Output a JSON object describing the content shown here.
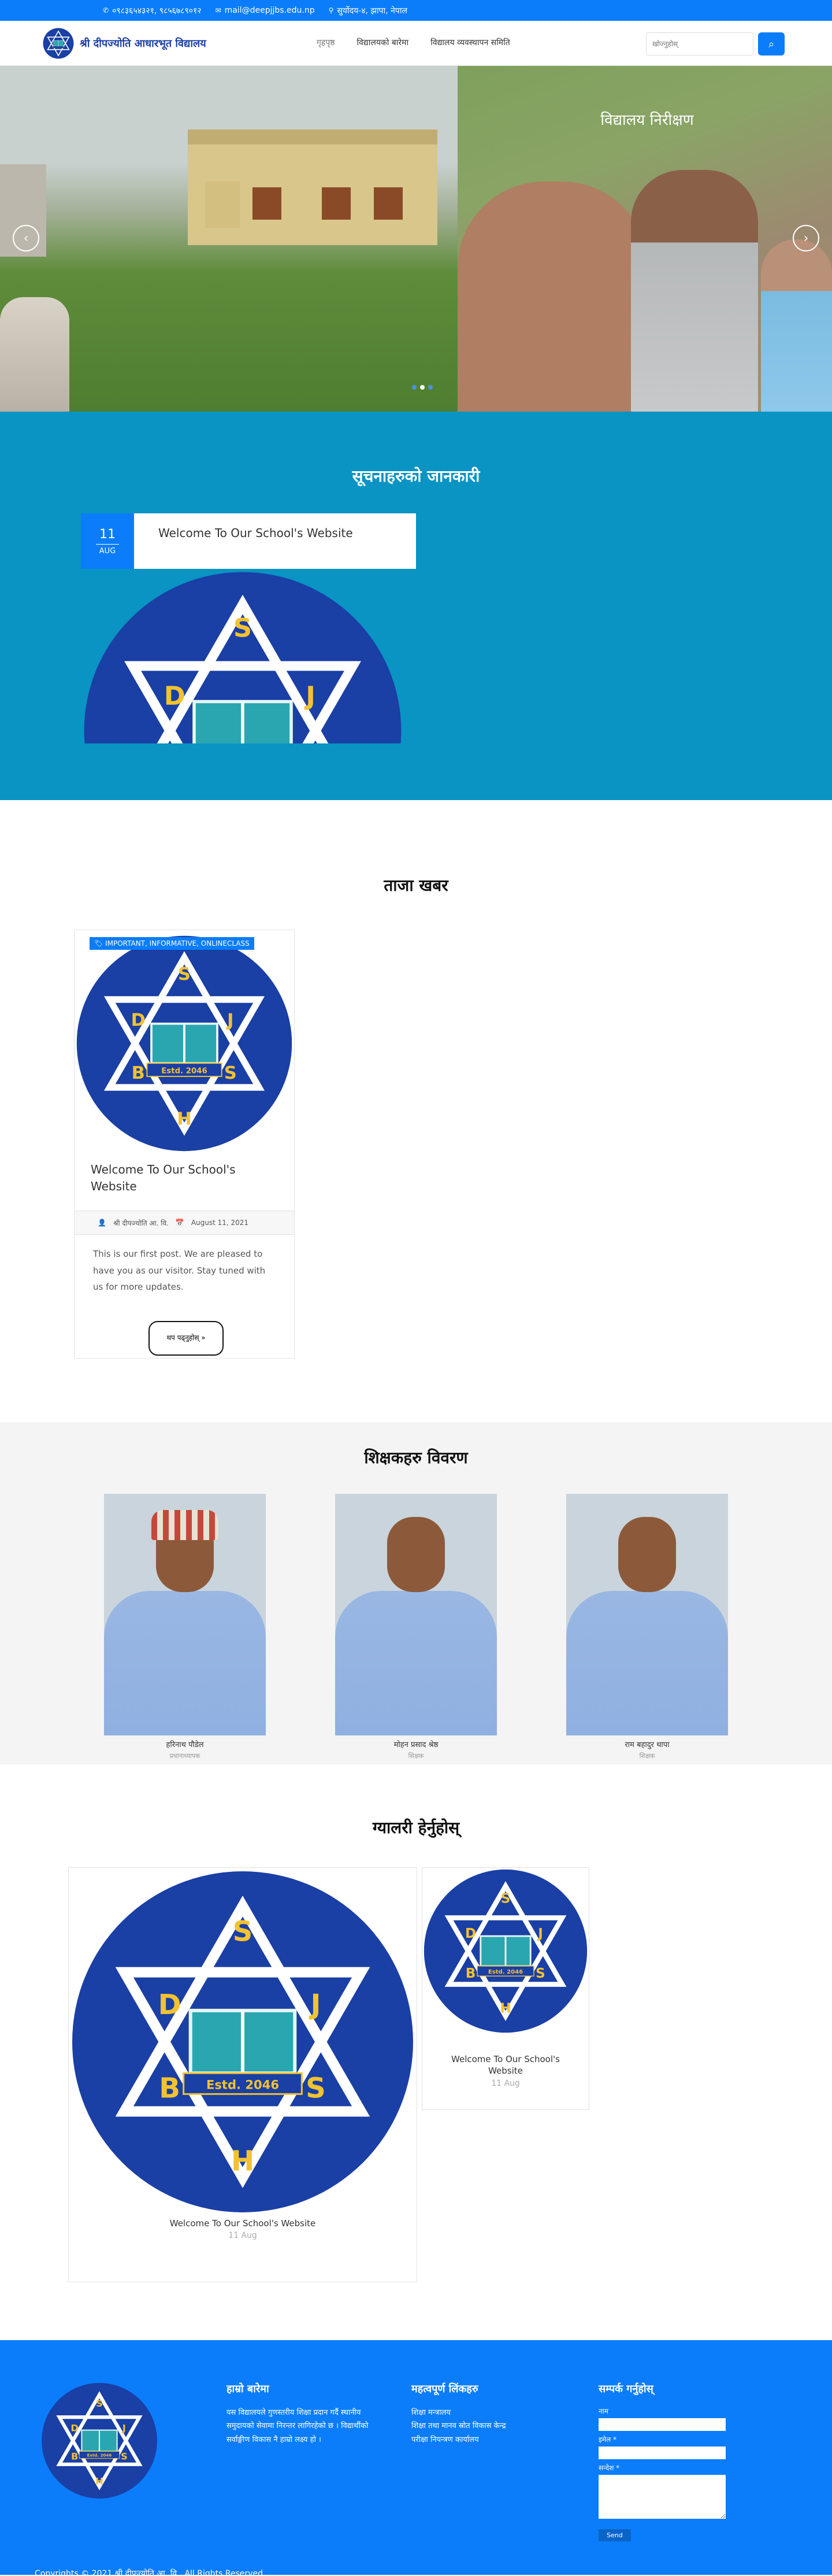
{
  "colors": {
    "primary": "#0b7dfa",
    "notice_bg": "#0994c4",
    "staff_bg": "#f4f4f4",
    "logo_blue": "#1a3fa5",
    "logo_gold": "#f2c230"
  },
  "topbar": {
    "phone_icon": "phone-icon",
    "phone": "०९८३६५४३२१, ९८५६७८९०१२",
    "mail_icon": "mail-icon",
    "email": "mail@deepjjbs.edu.np",
    "location_icon": "location-pin-icon",
    "address": "सुर्योदय-४, झापा, नेपाल"
  },
  "header": {
    "school_name": "श्री दीपज्योति आधारभूत विद्यालय",
    "nav": [
      {
        "label": "गृहपृष्ठ",
        "active": true
      },
      {
        "label": "विद्यालयको बारेमा",
        "active": false
      },
      {
        "label": "विद्यालय व्यवस्थापन समिति",
        "active": false
      }
    ],
    "search_placeholder": "खोज्नुहोस्",
    "search_icon": "search-icon"
  },
  "logo": {
    "letters": [
      "S",
      "D",
      "J",
      "B",
      "S",
      "H"
    ],
    "estd": "Estd. 2046"
  },
  "slider": {
    "caption": "विद्यालय निरीक्षण",
    "prev_icon": "chevron-left-icon",
    "next_icon": "chevron-right-icon",
    "dot_count": 3,
    "active_dot": 1
  },
  "notices": {
    "title": "सूचनाहरुको जानकारी",
    "items": [
      {
        "day": "11",
        "month": "AUG",
        "title": "Welcome To Our School's Website"
      }
    ]
  },
  "blog": {
    "title": "ताजा खबर",
    "posts": [
      {
        "tag_icon": "tag-icon",
        "tags": "IMPORTANT, INFORMATIVE, ONLINECLASS",
        "title": "Welcome To Our School's Website",
        "author_icon": "user-icon",
        "author": "श्री दीपज्योति आ. वि.",
        "date_icon": "calendar-icon",
        "date": "August 11, 2021",
        "excerpt": "This is our first post. We are pleased to have you as our visitor. Stay tuned with us for more updates.",
        "button": "थप पढ्नुहोस् »"
      }
    ]
  },
  "staff": {
    "title": "शिक्षकहरु विवरण",
    "members": [
      {
        "name": "हरिनाथ पौडेल",
        "role": "प्रधानाध्यापक"
      },
      {
        "name": "मोहन प्रसाद श्रेष्ठ",
        "role": "शिक्षक"
      },
      {
        "name": "राम बहादुर थापा",
        "role": "शिक्षक"
      }
    ]
  },
  "gallery": {
    "title": "ग्यालरी हेर्नुहोस्",
    "items": [
      {
        "caption": "Welcome To Our School's Website",
        "date": "11 Aug"
      },
      {
        "caption": "Welcome To Our School's Website",
        "date": "11 Aug"
      }
    ]
  },
  "footer": {
    "about_title": "हाम्रो बारेमा",
    "about_text": "यस विद्यालयले गुणस्तरीय शिक्षा प्रदान गर्दै स्थानीय समुदायको सेवामा निरन्तर लागिरहेको छ । विद्यार्थीको सर्वाङ्गीण विकास नै हाम्रो लक्ष्य हो ।",
    "links_title": "महत्वपूर्ण लिंकहरु",
    "links": [
      "शिक्षा मन्त्रालय",
      "शिक्षा तथा मानव स्रोत विकास केन्द्र",
      "परीक्षा नियन्त्रण कार्यालय"
    ],
    "contact_title": "सम्पर्क गर्नुहोस्",
    "name_label": "नाम",
    "email_label": "इमेल *",
    "message_label": "सन्देश *",
    "send": "Send",
    "copyright": "Copyrights © 2021 श्री दीपज्योति आ. वि.. All Rights Reserved."
  }
}
